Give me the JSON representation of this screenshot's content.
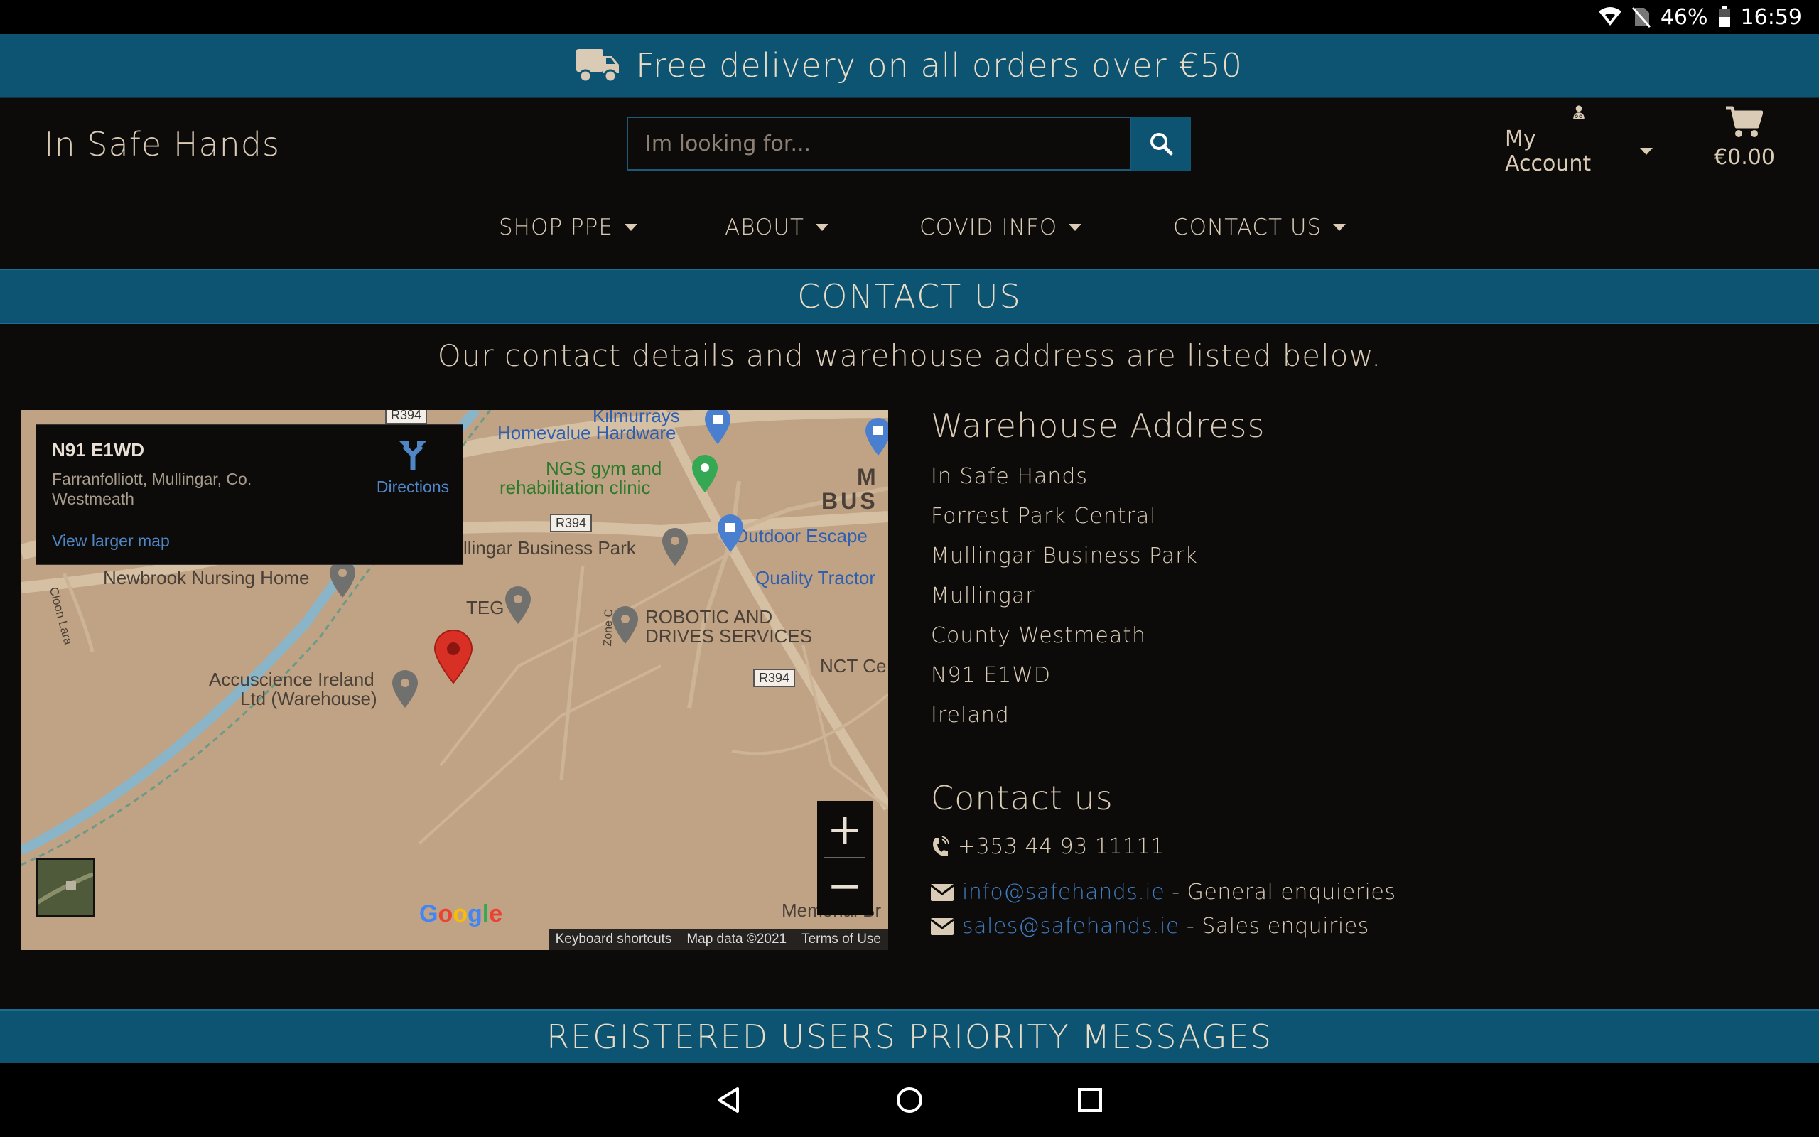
{
  "status_bar": {
    "battery": "46%",
    "time": "16:59"
  },
  "promo": {
    "text": "Free delivery on all orders over €50",
    "icon": "truck-icon"
  },
  "header": {
    "logo": "In Safe Hands",
    "search": {
      "placeholder": "Im looking for...",
      "value": ""
    },
    "account_label": "My Account",
    "cart_total": "€0.00"
  },
  "nav": {
    "items": [
      {
        "label": "SHOP PPE"
      },
      {
        "label": "ABOUT"
      },
      {
        "label": "COVID INFO"
      },
      {
        "label": "CONTACT US"
      }
    ]
  },
  "page": {
    "title": "CONTACT US",
    "subtitle": "Our contact details and warehouse address are listed below."
  },
  "map": {
    "info": {
      "title": "N91 E1WD",
      "address": "Farranfolliott, Mullingar, Co. Westmeath",
      "directions": "Directions",
      "larger_map": "View larger map"
    },
    "pois": [
      "Kilmurrays",
      "Homevalue Hardware",
      "NGS gym and",
      "rehabilitation clinic",
      "llingar Business Park",
      "Outdoor Escape",
      "Quality Tractor",
      "Newbrook Nursing Home",
      "TEG",
      "ROBOTIC AND",
      "DRIVES SERVICES",
      "Accuscience Ireland",
      "Ltd (Warehouse)",
      "NCT Ce",
      "Memorial Br",
      "M",
      "BUS",
      "Cloon Lara",
      "Zone C"
    ],
    "roads": [
      "R394",
      "R394",
      "R394"
    ],
    "zoom_in": "+",
    "zoom_out": "−",
    "footer": [
      "Keyboard shortcuts",
      "Map data ©2021",
      "Terms of Use"
    ],
    "logo": "Google"
  },
  "warehouse": {
    "title": "Warehouse Address",
    "lines": [
      "In Safe Hands",
      "Forrest Park Central",
      "Mullingar Business Park",
      "Mullingar",
      "County Westmeath",
      "N91 E1WD",
      "Ireland"
    ]
  },
  "contact": {
    "title": "Contact us",
    "phone": "+353 44 93 11111",
    "emails": [
      {
        "address": "info@safehands.ie",
        "desc": " - General enquieries"
      },
      {
        "address": "sales@safehands.ie",
        "desc": " - Sales enquiries"
      }
    ]
  },
  "priority": {
    "title": "REGISTERED USERS PRIORITY MESSAGES"
  },
  "colors": {
    "accent": "#0d5372",
    "background": "#0c0b0a",
    "text": "#d9cbb6",
    "link": "#3f7bc0"
  }
}
